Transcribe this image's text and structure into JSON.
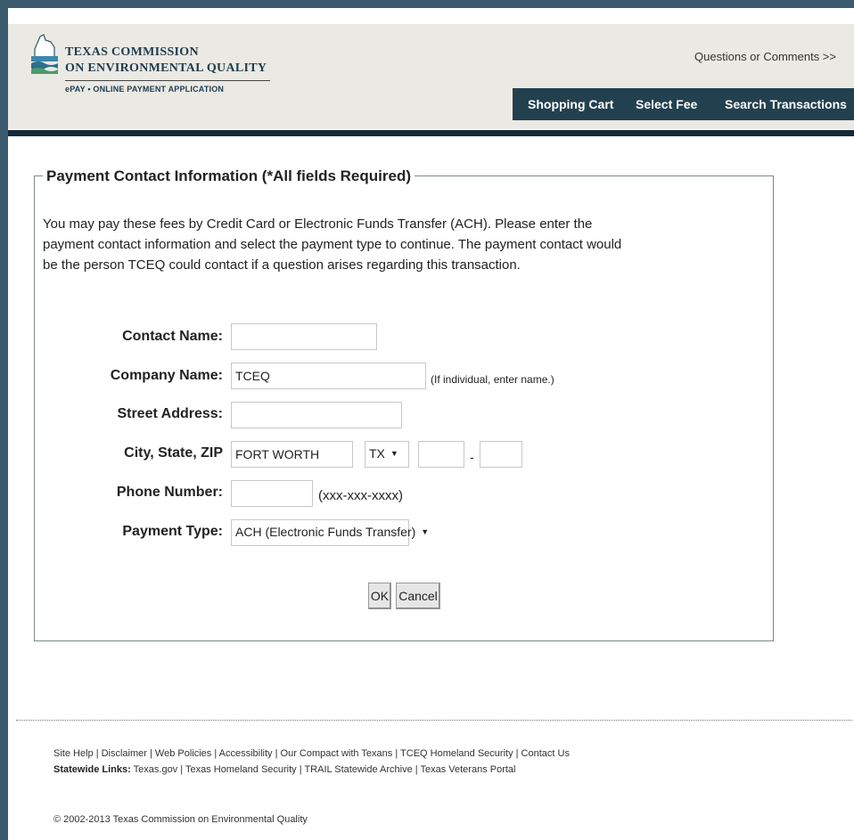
{
  "header": {
    "org_line1": "TEXAS COMMISSION",
    "org_line2": "ON ENVIRONMENTAL QUALITY",
    "app_subtitle": "ePAY • ONLINE PAYMENT APPLICATION",
    "questions_link": "Questions or Comments >>",
    "nav": {
      "shopping_cart": "Shopping Cart",
      "select_fee": "Select Fee",
      "search_transactions": "Search Transactions"
    }
  },
  "form": {
    "legend": "Payment Contact Information (*All fields Required)",
    "intro": "You may pay these fees by Credit Card or Electronic Funds Transfer (ACH). Please enter the payment contact information and select the payment type to continue. The payment contact would be the person TCEQ could contact if a question arises regarding this transaction.",
    "contact_name": {
      "label": "Contact Name:",
      "value": ""
    },
    "company_name": {
      "label": "Company Name:",
      "value": "TCEQ",
      "hint": "(If individual, enter name.)"
    },
    "street_address": {
      "label": "Street Address:",
      "value": ""
    },
    "city_state_zip": {
      "label": "City, State, ZIP",
      "city": "FORT WORTH",
      "state": "TX",
      "zip": "",
      "zip_sep": "-",
      "zip4": ""
    },
    "phone": {
      "label": "Phone Number:",
      "value": "",
      "hint": "(xxx-xxx-xxxx)"
    },
    "payment_type": {
      "label": "Payment Type:",
      "value": "ACH (Electronic Funds Transfer)"
    },
    "ok_label": "OK",
    "cancel_label": "Cancel"
  },
  "footer": {
    "links_line": "Site Help | Disclaimer | Web Policies | Accessibility | Our Compact with Texans | TCEQ Homeland Security | Contact Us",
    "statewide_label": "Statewide Links:",
    "statewide_links": "Texas.gov | Texas Homeland Security | TRAIL Statewide Archive | Texas Veterans Portal",
    "copyright": "© 2002-2013 Texas Commission on Environmental Quality"
  },
  "colors": {
    "frame": "#3b5a6e",
    "header_bg": "#ebe9e3",
    "navbar": "#23404f"
  }
}
